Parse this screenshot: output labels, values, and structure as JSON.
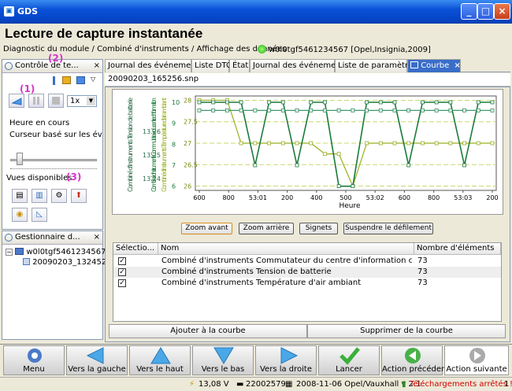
{
  "window": {
    "title": "GDS"
  },
  "heading": "Lecture de capture instantanée",
  "breadcrumb": "Diagnostic du module / Combiné d'instruments / Affichage des données",
  "vehicle": "w0l0tgf5461234567 [Opel,Insignia,2009]",
  "left_panel": {
    "tab_label": "Contrôle de te...",
    "speed_value": "1x",
    "heure_label": "Heure en cours",
    "cursor_label": "Curseur basé sur les événe",
    "vues_label": "Vues disponibles",
    "annotations": [
      "(1)",
      "(2)",
      "(3)"
    ]
  },
  "manager_panel": {
    "tab_label": "Gestionnaire d...",
    "tree": [
      "w0l0tgf5461234567",
      "20090203_132452"
    ]
  },
  "tabs": [
    {
      "label": "Journal des événements"
    },
    {
      "label": "Liste DTC"
    },
    {
      "label": "État"
    },
    {
      "label": "Journal des événements"
    },
    {
      "label": "Liste de paramètres"
    },
    {
      "label": "Courbe"
    }
  ],
  "file_name": "20090203_165256.snp",
  "chart_buttons": {
    "zoom_in": "Zoom avant",
    "zoom_out": "Zoom arrière",
    "bookmarks": "Signets",
    "suspend": "Suspendre le défilement"
  },
  "table": {
    "headers": [
      "Sélectio...",
      "Nom",
      "Nombre d'éléments"
    ],
    "rows": [
      {
        "name": "Combiné d'instruments Commutateur du centre d'information conduct...",
        "count": "73"
      },
      {
        "name": "Combiné d'instruments Tension de batterie",
        "count": "73"
      },
      {
        "name": "Combiné d'instruments Température d'air ambiant",
        "count": "73"
      }
    ]
  },
  "actions": {
    "add": "Ajouter à la courbe",
    "remove": "Supprimer de la courbe"
  },
  "nav": [
    "Menu",
    "Vers la gauche",
    "Vers le haut",
    "Vers le bas",
    "Vers la droite",
    "Lancer",
    "Action précédente",
    "Action suivante"
  ],
  "status": {
    "voltage": "13,08 V",
    "serial": "22002579",
    "version": "2008-11-06 Opel/Vauxhall v 2.1",
    "downloads": "Téléchargements arrêtés !",
    "page_num": "1"
  },
  "chart_data": {
    "type": "line",
    "xlabel": "Heure",
    "x_tick_labels": [
      "600",
      "800",
      "53:01",
      "200",
      "400",
      "500",
      "53:02",
      "600",
      "800",
      "53:03",
      "200"
    ],
    "series": [
      {
        "name": "Combiné d'instruments Tension de batterie",
        "axis": "left",
        "color": "#2a8a5a",
        "ylim": [
          13.235,
          13.275
        ],
        "yticks": [
          "13.24",
          "13.25",
          "13.26"
        ],
        "values": [
          13.2689,
          13.2689,
          13.2689,
          13.2689,
          13.2689,
          13.2689,
          13.2689,
          13.2689,
          13.2689,
          13.2689,
          13.2689,
          13.2689,
          13.2689,
          13.2689,
          13.2689,
          13.2689,
          13.2689,
          13.2689,
          13.2689,
          13.2689,
          13.2689,
          13.2689
        ]
      },
      {
        "name": "Combiné d'instruments Commutateur du centre d'information conduct...",
        "axis": "mid",
        "color": "#1a7a3a",
        "ylim": [
          5.8,
          10.3
        ],
        "yticks": [
          "6",
          "7",
          "8",
          "9",
          "10"
        ],
        "values": [
          10,
          10,
          10,
          10,
          7,
          10,
          10,
          7,
          10,
          10,
          6,
          6,
          10,
          10,
          10,
          7,
          10,
          10,
          10,
          7,
          10,
          10
        ]
      },
      {
        "name": "Combiné d'instruments Température d'air ambiant",
        "axis": "right",
        "color": "#9ab020",
        "ylim": [
          25.9,
          28.1
        ],
        "yticks": [
          "26",
          "26.5",
          "27",
          "27.5",
          "28"
        ],
        "values": [
          28,
          28,
          28,
          27,
          27,
          27,
          27,
          27,
          27,
          26.75,
          26.75,
          26,
          27,
          27,
          27,
          27,
          27,
          27,
          27,
          27,
          27,
          27
        ]
      }
    ]
  },
  "colors": {
    "accent": "#3a6ec8",
    "titlebar": "#0a52d8",
    "chart_green": "#2a8a5a",
    "chart_yellow": "#c8d030",
    "warning_red": "#d40000"
  }
}
